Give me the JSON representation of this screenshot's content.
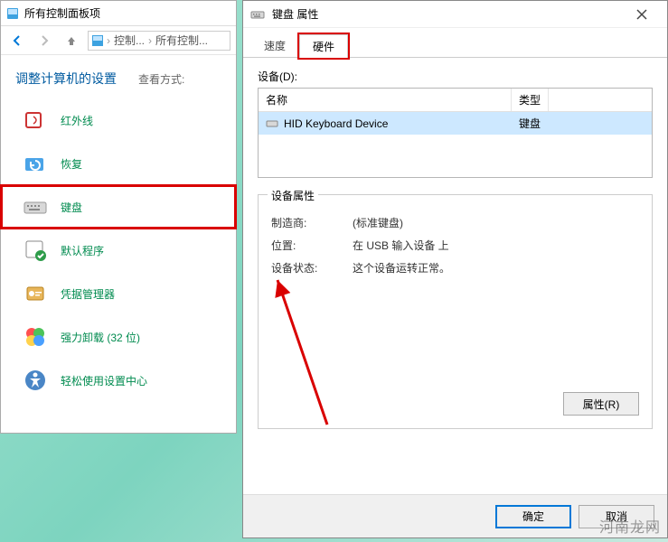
{
  "cp": {
    "windowTitle": "所有控制面板项",
    "breadcrumb": {
      "a": "控制...",
      "b": "所有控制..."
    },
    "heading": "调整计算机的设置",
    "viewMode": "查看方式:",
    "items": [
      {
        "label": "红外线"
      },
      {
        "label": "恢复"
      },
      {
        "label": "键盘"
      },
      {
        "label": "默认程序"
      },
      {
        "label": "凭据管理器"
      },
      {
        "label": "强力卸载 (32 位)"
      },
      {
        "label": "轻松使用设置中心"
      }
    ]
  },
  "dlg": {
    "title": "键盘 属性",
    "tabs": {
      "speed": "速度",
      "hardware": "硬件"
    },
    "devicesLabel": "设备(D):",
    "cols": {
      "name": "名称",
      "type": "类型"
    },
    "row": {
      "name": "HID Keyboard Device",
      "type": "键盘"
    },
    "fieldsetTitle": "设备属性",
    "props": {
      "mfrK": "制造商:",
      "mfrV": "(标准键盘)",
      "locK": "位置:",
      "locV": "在 USB 输入设备 上",
      "statK": "设备状态:",
      "statV": "这个设备运转正常。"
    },
    "propBtn": "属性(R)",
    "ok": "确定",
    "cancel": "取消"
  },
  "watermark": "河南龙网"
}
